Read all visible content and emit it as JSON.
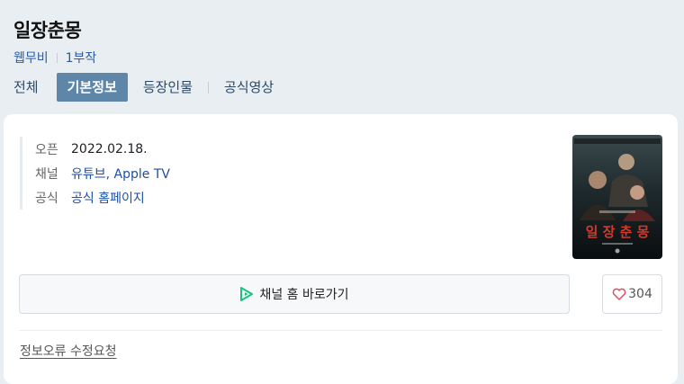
{
  "title": "일장춘몽",
  "meta": {
    "type": "웹무비",
    "season": "1부작"
  },
  "tabs": [
    "전체",
    "기본정보",
    "등장인물",
    "공식영상"
  ],
  "info": [
    {
      "label": "오픈",
      "value": "2022.02.18."
    },
    {
      "label": "채널",
      "value": "유튜브, Apple TV"
    },
    {
      "label": "공식",
      "value": "공식 홈페이지"
    }
  ],
  "poster": {
    "title_text": "일 장 춘 몽"
  },
  "channel_button": {
    "label": "채널 홈 바로가기",
    "icon": "play-icon",
    "icon_color": "#19c37d"
  },
  "like_button": {
    "count": "304",
    "icon": "heart-icon",
    "icon_color": "#e0455a"
  },
  "report_link": "정보오류 수정요청",
  "colors": {
    "accent": "#5e86a8",
    "link": "#1d4fa5",
    "background": "#e9eef3"
  }
}
